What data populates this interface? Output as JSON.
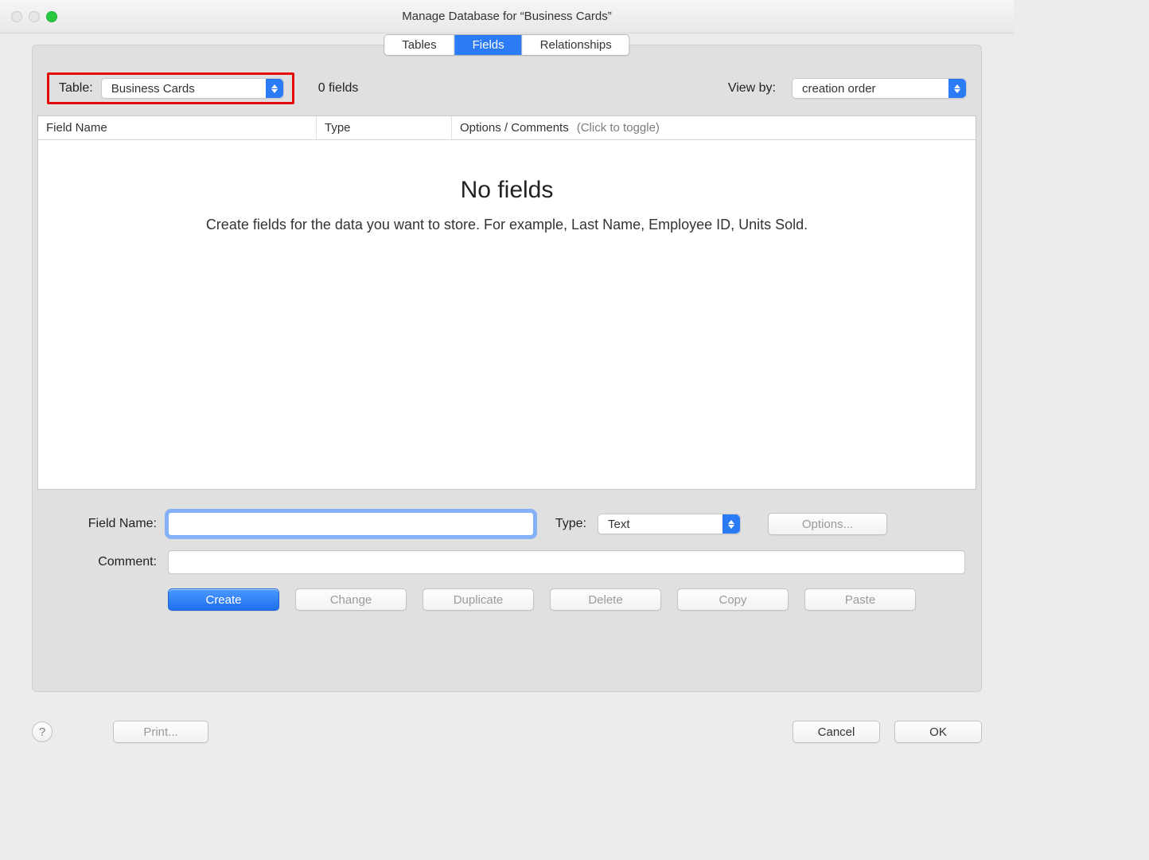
{
  "window": {
    "title": "Manage Database for “Business Cards”"
  },
  "tabs": {
    "tables": "Tables",
    "fields": "Fields",
    "relationships": "Relationships"
  },
  "toprow": {
    "table_label": "Table:",
    "table_value": "Business Cards",
    "field_count": "0 fields",
    "viewby_label": "View by:",
    "viewby_value": "creation order"
  },
  "grid": {
    "col_fieldname": "Field Name",
    "col_type": "Type",
    "col_options": "Options / Comments",
    "col_options_hint": "(Click to toggle)",
    "empty_title": "No fields",
    "empty_sub": "Create fields for the data you want to store. For example, Last Name, Employee ID, Units Sold."
  },
  "form": {
    "fieldname_label": "Field Name:",
    "fieldname_value": "",
    "type_label": "Type:",
    "type_value": "Text",
    "options_btn": "Options...",
    "comment_label": "Comment:",
    "comment_value": ""
  },
  "buttons": {
    "create": "Create",
    "change": "Change",
    "duplicate": "Duplicate",
    "delete": "Delete",
    "copy": "Copy",
    "paste": "Paste",
    "print": "Print...",
    "cancel": "Cancel",
    "ok": "OK"
  },
  "help": "?"
}
